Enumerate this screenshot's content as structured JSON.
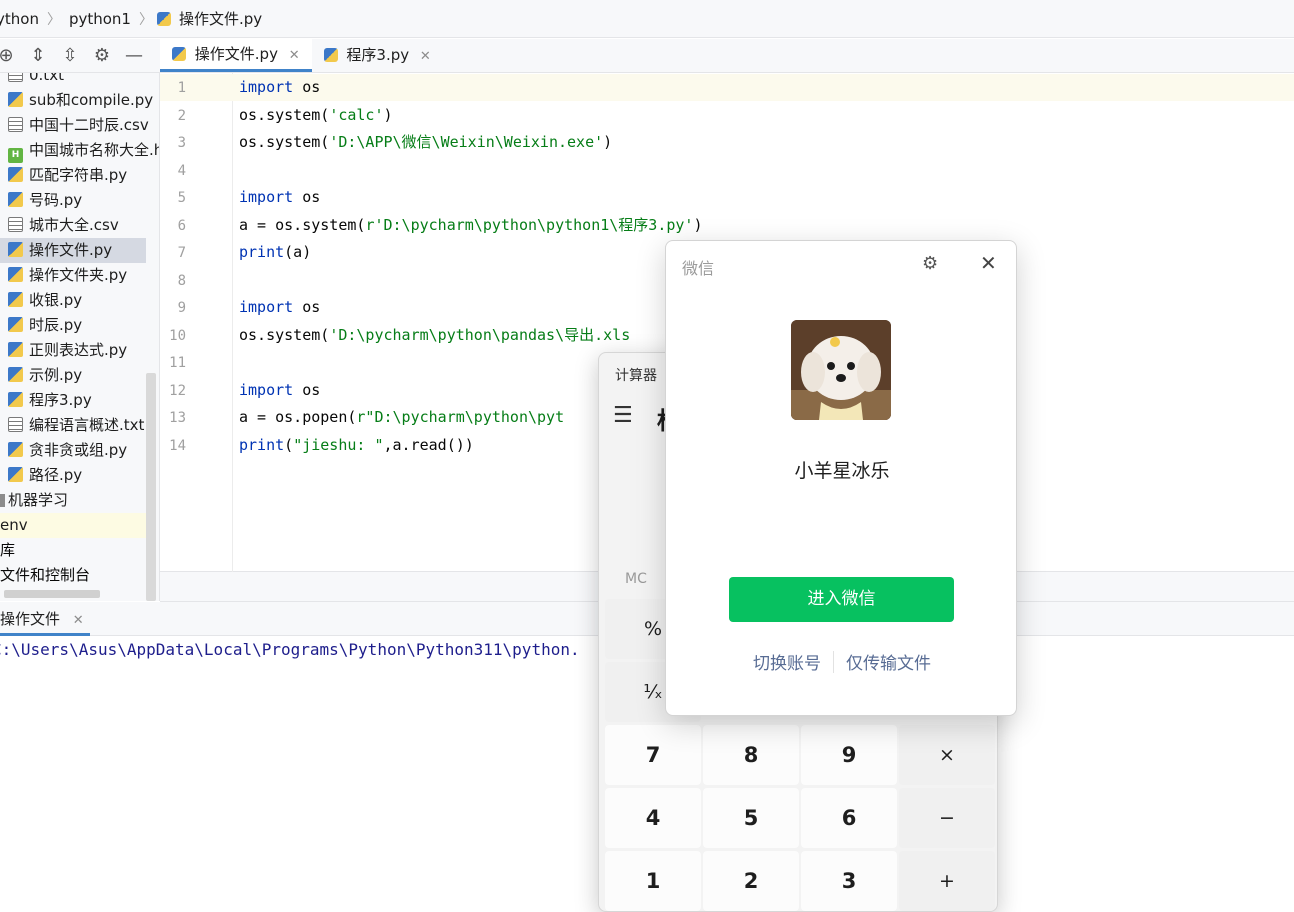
{
  "breadcrumb": {
    "items": [
      "ython",
      "python1",
      "操作文件.py"
    ]
  },
  "project_toolbar": {
    "icons": [
      "target-icon",
      "expand-all-icon",
      "collapse-all-icon",
      "gear-icon",
      "minus-icon"
    ]
  },
  "tree": {
    "items": [
      {
        "label": "0.txt",
        "type": "txt"
      },
      {
        "label": "sub和compile.py",
        "type": "py"
      },
      {
        "label": "中国十二时辰.csv",
        "type": "csv"
      },
      {
        "label": "中国城市名称大全.h",
        "type": "html"
      },
      {
        "label": "匹配字符串.py",
        "type": "py"
      },
      {
        "label": "号码.py",
        "type": "py"
      },
      {
        "label": "城市大全.csv",
        "type": "csv"
      },
      {
        "label": "操作文件.py",
        "type": "py",
        "selected": true
      },
      {
        "label": "操作文件夹.py",
        "type": "py"
      },
      {
        "label": "收银.py",
        "type": "py"
      },
      {
        "label": "时辰.py",
        "type": "py"
      },
      {
        "label": "正则表达式.py",
        "type": "py"
      },
      {
        "label": "示例.py",
        "type": "py"
      },
      {
        "label": "程序3.py",
        "type": "py"
      },
      {
        "label": "编程语言概述.txt",
        "type": "txt"
      },
      {
        "label": "贪非贪或组.py",
        "type": "py"
      },
      {
        "label": "路径.py",
        "type": "py"
      }
    ],
    "folder_ml": "机器学习",
    "venv": "env",
    "lib": "库",
    "scratches": "文件和控制台"
  },
  "editor_tabs": [
    {
      "label": "操作文件.py",
      "active": true
    },
    {
      "label": "程序3.py",
      "active": false
    }
  ],
  "code_lines": [
    {
      "n": "1",
      "parts": [
        [
          "kw",
          "import"
        ],
        [
          "plain",
          " os"
        ]
      ]
    },
    {
      "n": "2",
      "parts": [
        [
          "plain",
          "os.system("
        ],
        [
          "str",
          "'calc'"
        ],
        [
          "plain",
          ")"
        ]
      ]
    },
    {
      "n": "3",
      "parts": [
        [
          "plain",
          "os.system("
        ],
        [
          "str",
          "'D:\\APP\\微信\\Weixin\\Weixin.exe'"
        ],
        [
          "plain",
          ")"
        ]
      ]
    },
    {
      "n": "4",
      "parts": []
    },
    {
      "n": "5",
      "parts": [
        [
          "kw",
          "import"
        ],
        [
          "plain",
          " os"
        ]
      ]
    },
    {
      "n": "6",
      "parts": [
        [
          "plain",
          "a = os.system("
        ],
        [
          "str",
          "r'D:\\pycharm\\python\\python1\\程序3.py'"
        ],
        [
          "plain",
          ")"
        ]
      ]
    },
    {
      "n": "7",
      "parts": [
        [
          "kw",
          "print"
        ],
        [
          "plain",
          "(a)"
        ]
      ]
    },
    {
      "n": "8",
      "parts": []
    },
    {
      "n": "9",
      "parts": [
        [
          "kw",
          "import"
        ],
        [
          "plain",
          " os"
        ]
      ]
    },
    {
      "n": "10",
      "parts": [
        [
          "plain",
          "os.system("
        ],
        [
          "str",
          "'D:\\pycharm\\python\\pandas\\导出.xls"
        ]
      ]
    },
    {
      "n": "11",
      "parts": []
    },
    {
      "n": "12",
      "parts": [
        [
          "kw",
          "import"
        ],
        [
          "plain",
          " os"
        ]
      ]
    },
    {
      "n": "13",
      "parts": [
        [
          "plain",
          "a = os.popen("
        ],
        [
          "str",
          "r\"D:\\pycharm\\python\\pyt"
        ]
      ]
    },
    {
      "n": "14",
      "parts": [
        [
          "kw",
          "print"
        ],
        [
          "plain",
          "("
        ],
        [
          "str",
          "\"jieshu: \""
        ],
        [
          "plain",
          ",a.read())"
        ]
      ]
    }
  ],
  "run_panel": {
    "tab_label": "操作文件",
    "output": "C:\\Users\\Asus\\AppData\\Local\\Programs\\Python\\Python311\\python."
  },
  "calculator": {
    "title": "计算器",
    "mode_partial": "标",
    "memory_label": "MC",
    "keys": [
      {
        "label": "%",
        "kind": "fn",
        "row": 0,
        "col": 0
      },
      {
        "label": "¹⁄ₓ",
        "kind": "fn",
        "row": 1,
        "col": 0
      },
      {
        "label": "7",
        "kind": "num",
        "row": 2,
        "col": 0
      },
      {
        "label": "8",
        "kind": "num",
        "row": 2,
        "col": 1
      },
      {
        "label": "9",
        "kind": "num",
        "row": 2,
        "col": 2
      },
      {
        "label": "×",
        "kind": "fn",
        "row": 2,
        "col": 3
      },
      {
        "label": "4",
        "kind": "num",
        "row": 3,
        "col": 0
      },
      {
        "label": "5",
        "kind": "num",
        "row": 3,
        "col": 1
      },
      {
        "label": "6",
        "kind": "num",
        "row": 3,
        "col": 2
      },
      {
        "label": "−",
        "kind": "fn",
        "row": 3,
        "col": 3
      },
      {
        "label": "1",
        "kind": "num",
        "row": 4,
        "col": 0
      },
      {
        "label": "2",
        "kind": "num",
        "row": 4,
        "col": 1
      },
      {
        "label": "3",
        "kind": "num",
        "row": 4,
        "col": 2
      },
      {
        "label": "+",
        "kind": "fn",
        "row": 4,
        "col": 3
      }
    ]
  },
  "wechat": {
    "title": "微信",
    "username": "小羊星冰乐",
    "enter_label": "进入微信",
    "switch_account": "切换账号",
    "transfer_only": "仅传输文件",
    "accent": "#07c160"
  }
}
